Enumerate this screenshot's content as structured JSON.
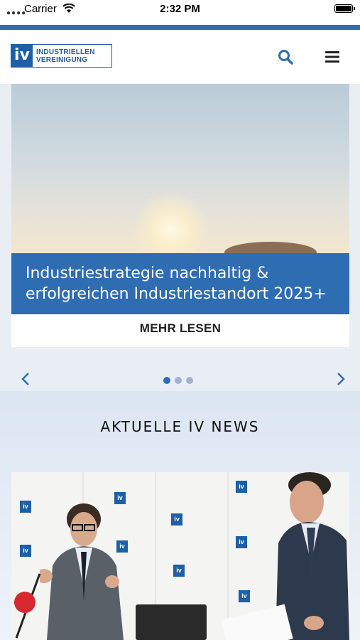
{
  "status_bar": {
    "carrier": "Carrier",
    "time": "2:32 PM"
  },
  "header": {
    "logo_mark": "iv",
    "logo_line1": "INDUSTRIELLEN",
    "logo_line2": "VEREINIGUNG",
    "icons": [
      "search-icon",
      "menu-icon"
    ]
  },
  "slider": {
    "title": "Industriestrategie nachhaltig & erfolgreichen Industriestandort 2025+",
    "read_more": "MEHR LESEN",
    "slide_count": 3,
    "active_index": 0
  },
  "news": {
    "title": "AKTUELLE IV NEWS",
    "backdrop_logo": "iv"
  },
  "colors": {
    "brand_blue": "#2f6db3",
    "logo_blue": "#1e5fa5",
    "section_bg": "#e9eef5"
  }
}
